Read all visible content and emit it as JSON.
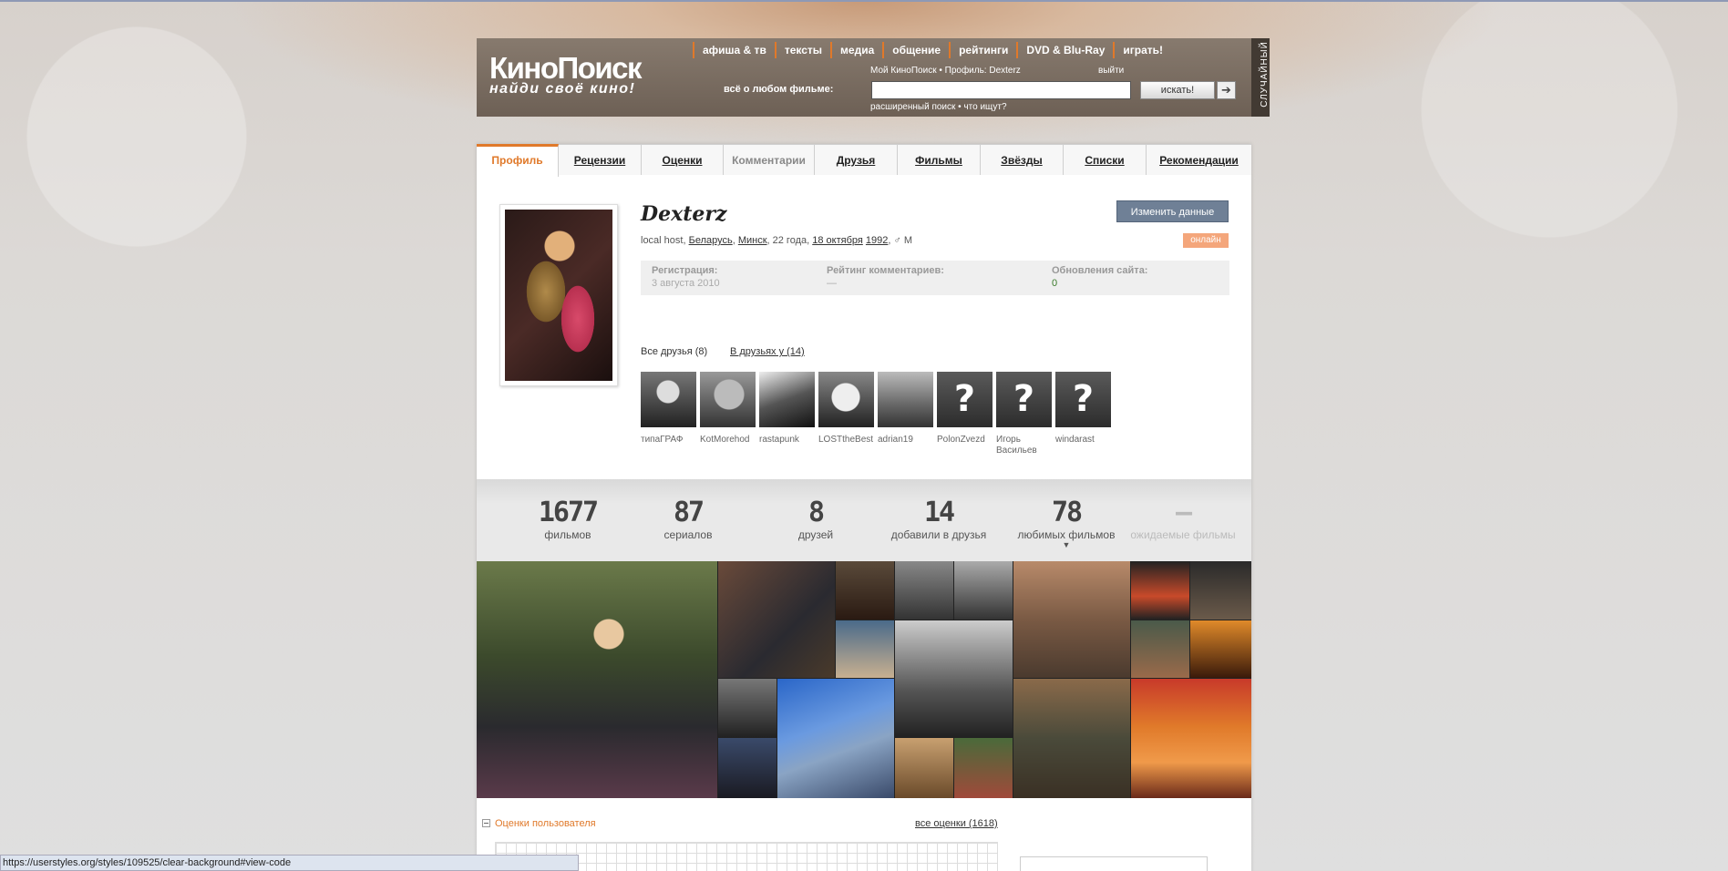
{
  "header": {
    "logo_line1": "КиноПоиск",
    "logo_line2": "найди своё кино!",
    "about": "всё о любом фильме:",
    "nav": [
      "афиша & тв",
      "тексты",
      "медиа",
      "общение",
      "рейтинги",
      "DVD & Blu-Ray",
      "играть!"
    ],
    "user_links": "Мой КиноПоиск  •  Профиль: Dexterz",
    "logout": "выйти",
    "search_value": "",
    "search_button": "искать!",
    "go_icon": "arrow-right-icon",
    "advanced": "расширенный поиск  •  что ищут?",
    "random": "СЛУЧАЙНЫЙ"
  },
  "tabs": [
    "Профиль",
    "Рецензии",
    "Оценки",
    "Комментарии",
    "Друзья",
    "Фильмы",
    "Звёзды",
    "Списки",
    "Рекомендации"
  ],
  "profile": {
    "username": "Dexterz",
    "info_prefix": "local host, ",
    "country": "Беларусь",
    "city": "Минск",
    "age": ", 22 года, ",
    "birth_date": "18 октября",
    "birth_year": "1992",
    "gender": "М",
    "edit_button": "Изменить данные",
    "online": "онлайн",
    "registration_label": "Регистрация:",
    "registration_value": "3 августа 2010",
    "comments_rating_label": "Рейтинг комментариев:",
    "comments_rating_value": "—",
    "updates_label": "Обновления сайта:",
    "updates_value": "0"
  },
  "friends": {
    "all_tab": "Все друзья (8)",
    "in_friends_tab": "В друзьях у (14)",
    "list": [
      {
        "name": "типаГРАФ"
      },
      {
        "name": "KotMorehod"
      },
      {
        "name": "rastapunk"
      },
      {
        "name": "LOSTtheBest"
      },
      {
        "name": "adrian19"
      },
      {
        "name": "PolonZvezd"
      },
      {
        "name": "Игорь Васильев"
      },
      {
        "name": "windarast"
      }
    ]
  },
  "counters": [
    {
      "value": "1677",
      "label": "фильмов"
    },
    {
      "value": "87",
      "label": "сериалов"
    },
    {
      "value": "8",
      "label": "друзей"
    },
    {
      "value": "14",
      "label": "добавили в друзья"
    },
    {
      "value": "78",
      "label": "любимых фильмов"
    },
    {
      "value": "—",
      "label": "ожидаемые фильмы"
    }
  ],
  "ratings": {
    "title": "Оценки пользователя",
    "all": "все оценки (1618)"
  },
  "status_url": "https://userstyles.org/styles/109525/clear-background#view-code",
  "colors": {
    "accent": "#e0792a",
    "header": "#7d7065",
    "edit_button": "#6f8096",
    "online": "#f4a67b"
  }
}
